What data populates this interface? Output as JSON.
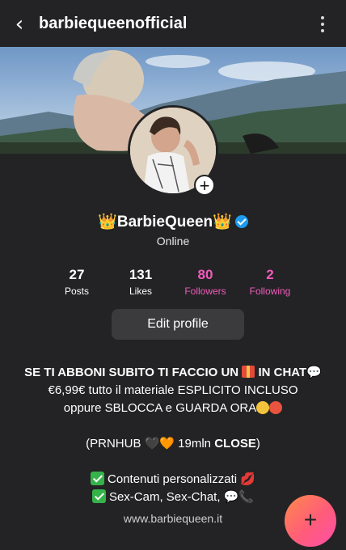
{
  "header": {
    "back_label": "‹",
    "username": "barbiequeenofficial",
    "menu_icon": "kebab-menu-icon"
  },
  "profile": {
    "display_name": "👑BarbieQueen👑",
    "verified": true,
    "status": "Online",
    "add_label": "+"
  },
  "stats": [
    {
      "value": "27",
      "label": "Posts"
    },
    {
      "value": "131",
      "label": "Likes"
    },
    {
      "value": "80",
      "label": "Followers"
    },
    {
      "value": "2",
      "label": "Following"
    }
  ],
  "edit_profile_label": "Edit profile",
  "bio": {
    "line1_bold_a": "SE TI ABBONI SUBITO TI FACCIO UN",
    "line1_bold_b": "IN CHAT",
    "line2": "€6,99€ tutto il materiale ESPLICITO INCLUSO",
    "line3": "oppure SBLOCCA e GUARDA ORA",
    "line4_a": "(PRNHUB",
    "line4_b": "19mln",
    "line4_c": "CLOSE",
    "line4_d": ")",
    "line5": "Contenuti personalizzati",
    "line6": "Sex-Cam, Sex-Chat,",
    "url": "www.barbiequeen.it"
  },
  "fab_label": "+",
  "colors": {
    "background": "#232325",
    "accent_pink": "#f15bbd",
    "verified_blue": "#1d9bf0",
    "button_gray": "#3b3b3e"
  }
}
